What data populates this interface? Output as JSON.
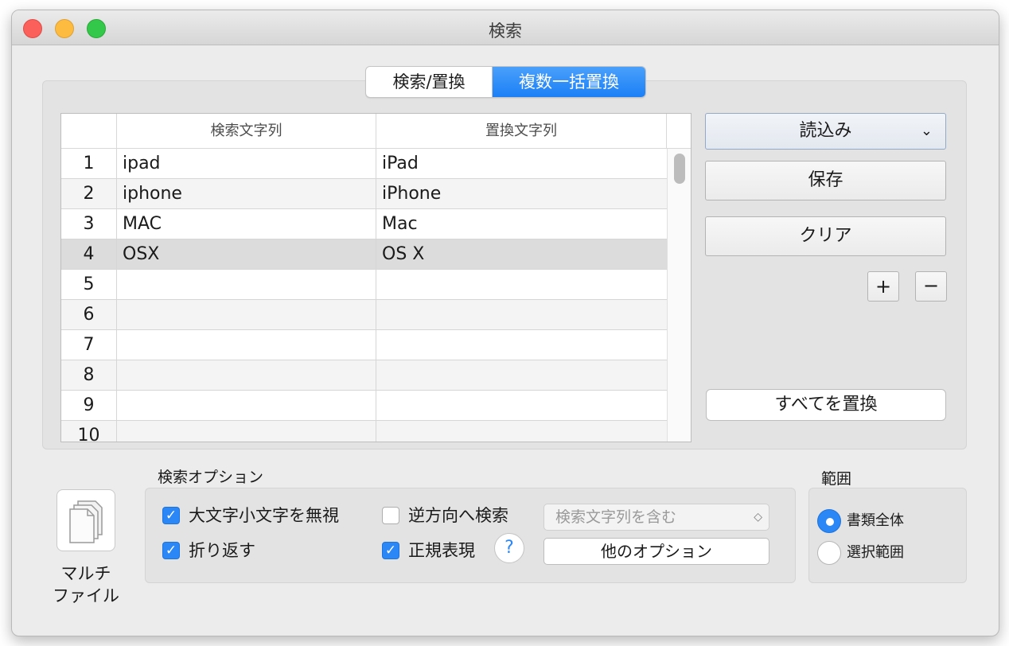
{
  "window": {
    "title": "検索"
  },
  "tabs": [
    {
      "label": "検索/置換",
      "active": false
    },
    {
      "label": "複数一括置換",
      "active": true
    }
  ],
  "table": {
    "headers": [
      "",
      "検索文字列",
      "置換文字列"
    ],
    "rows": [
      {
        "num": "1",
        "search": "ipad",
        "replace": "iPad"
      },
      {
        "num": "2",
        "search": "iphone",
        "replace": "iPhone"
      },
      {
        "num": "3",
        "search": "MAC",
        "replace": "Mac"
      },
      {
        "num": "4",
        "search": "OSX",
        "replace": "OS X",
        "selected": true
      },
      {
        "num": "5",
        "search": "",
        "replace": ""
      },
      {
        "num": "6",
        "search": "",
        "replace": ""
      },
      {
        "num": "7",
        "search": "",
        "replace": ""
      },
      {
        "num": "8",
        "search": "",
        "replace": ""
      },
      {
        "num": "9",
        "search": "",
        "replace": ""
      },
      {
        "num": "10",
        "search": "",
        "replace": ""
      }
    ]
  },
  "buttons": {
    "load": "読込み",
    "save": "保存",
    "clear": "クリア",
    "add": "+",
    "remove": "−",
    "replace_all": "すべてを置換"
  },
  "multi_file": {
    "label_line1": "マルチ",
    "label_line2": "ファイル"
  },
  "search_options": {
    "title": "検索オプション",
    "ignore_case": {
      "label": "大文字小文字を無視",
      "checked": true
    },
    "wrap_around": {
      "label": "折り返す",
      "checked": true
    },
    "reverse": {
      "label": "逆方向へ検索",
      "checked": false
    },
    "regex": {
      "label": "正規表現",
      "checked": true
    },
    "help": "?",
    "match_mode": "検索文字列を含む",
    "other_options": "他のオプション"
  },
  "range": {
    "title": "範囲",
    "whole_document": {
      "label": "書類全体",
      "selected": true
    },
    "selection": {
      "label": "選択範囲",
      "selected": false
    }
  },
  "colors": {
    "accent": "#2b87f6",
    "close": "#fc605b",
    "minimize": "#fdbc40",
    "maximize": "#34c84a"
  }
}
